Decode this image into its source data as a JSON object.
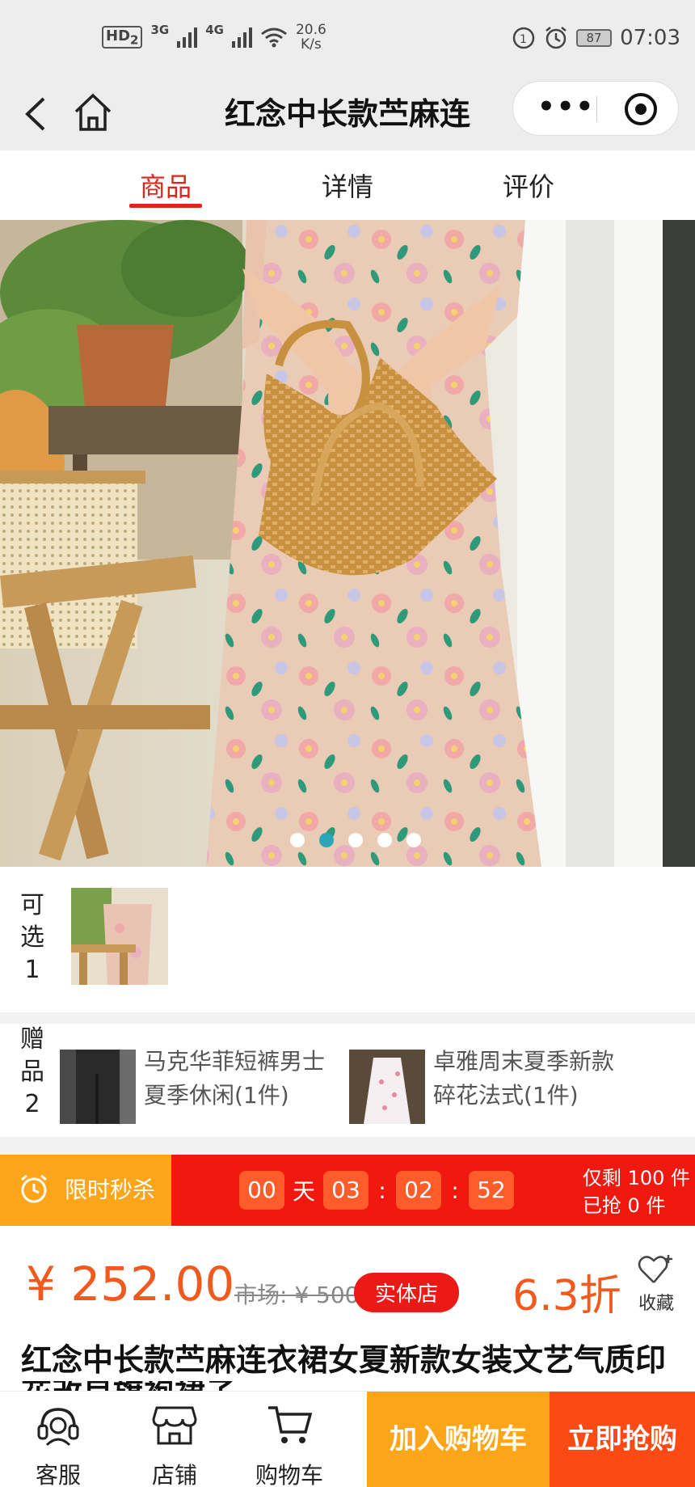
{
  "status_bar": {
    "hd": "HD",
    "hd_sub": "2",
    "net1": "3G",
    "net2": "4G",
    "speed_value": "20.6",
    "speed_unit": "K/s",
    "battery": "87",
    "time": "07:03"
  },
  "nav": {
    "title": "红念中长款苎麻连",
    "back_icon": "chevron-left-icon",
    "home_icon": "home-icon"
  },
  "tabs": [
    {
      "label": "商品",
      "active": true
    },
    {
      "label": "详情",
      "active": false
    },
    {
      "label": "评价",
      "active": false
    }
  ],
  "carousel": {
    "total": 5,
    "active_index": 1
  },
  "optional": {
    "label_chars": [
      "可",
      "选",
      "1"
    ]
  },
  "gifts": {
    "label_chars": [
      "赠",
      "品",
      "2"
    ],
    "items": [
      {
        "line1": "马克华菲短裤男士",
        "line2": "夏季休闲(1件)"
      },
      {
        "line1": "卓雅周末夏季新款",
        "line2": "碎花法式(1件)"
      }
    ]
  },
  "flash_sale": {
    "label": "限时秒杀",
    "days": "00",
    "day_unit": "天",
    "hours": "03",
    "minutes": "02",
    "seconds": "52",
    "remaining": "仅剩 100 件",
    "sold": "已抢 0 件",
    "colors": {
      "left": "#ffa51a",
      "bar": "#f1190f",
      "box": "#ff5c2c"
    }
  },
  "price": {
    "current": "¥ 252.00",
    "market": "市场: ¥ 500",
    "store_badge": "实体店",
    "discount": "6.3折",
    "favorite_label": "收藏"
  },
  "product": {
    "title": "红念中长款苎麻连衣裙女夏新款女装文艺气质印",
    "title_line2": "花改良旗袍裙子"
  },
  "bottom_bar": {
    "service": "客服",
    "store": "店铺",
    "cart": "购物车",
    "add_to_cart": "加入购物车",
    "buy_now": "立即抢购"
  },
  "colors": {
    "accent_red": "#e2231a",
    "price_orange": "#f05a1e",
    "cart_orange": "#ffa51a",
    "buy_red": "#fb4a14"
  }
}
